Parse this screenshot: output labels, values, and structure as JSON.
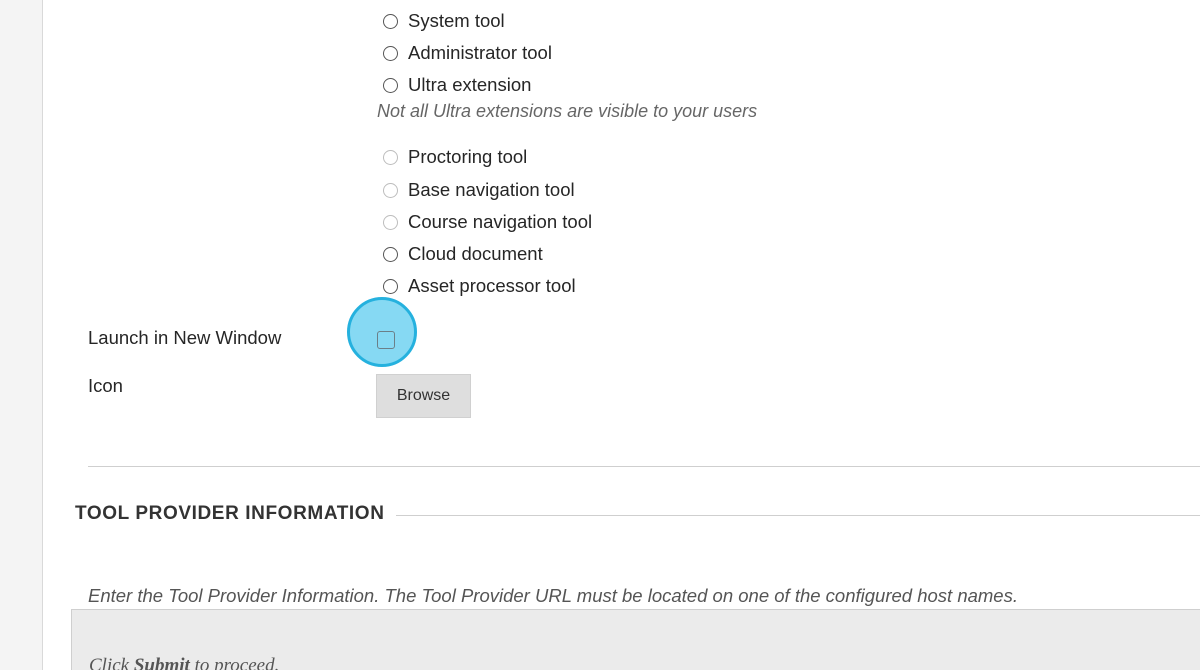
{
  "placement_options": [
    {
      "label": "System tool",
      "enabled": true,
      "checked": false
    },
    {
      "label": "Administrator tool",
      "enabled": true,
      "checked": false
    },
    {
      "label": "Ultra extension",
      "enabled": true,
      "checked": false
    }
  ],
  "ultra_note": "Not all Ultra extensions are visible to your users",
  "placement_options_more": [
    {
      "label": "Proctoring tool",
      "enabled": false,
      "checked": false
    },
    {
      "label": "Base navigation tool",
      "enabled": false,
      "checked": false
    },
    {
      "label": "Course navigation tool",
      "enabled": false,
      "checked": false
    },
    {
      "label": "Cloud document",
      "enabled": true,
      "checked": false
    },
    {
      "label": "Asset processor tool",
      "enabled": true,
      "checked": false
    }
  ],
  "launch_new_window": {
    "label": "Launch in New Window",
    "checked": false
  },
  "icon_field": {
    "label": "Icon",
    "button_label": "Browse"
  },
  "tool_provider_section": {
    "title": "TOOL PROVIDER INFORMATION",
    "instructions": "Enter the Tool Provider Information. The Tool Provider URL must be located on one of the configured host names."
  },
  "submit_hint": {
    "prefix": "Click ",
    "action": "Submit",
    "suffix": " to proceed."
  },
  "colors": {
    "focus_fill": "#86d9f3",
    "focus_border": "#25b1de",
    "divider": "#cfcfcf"
  }
}
